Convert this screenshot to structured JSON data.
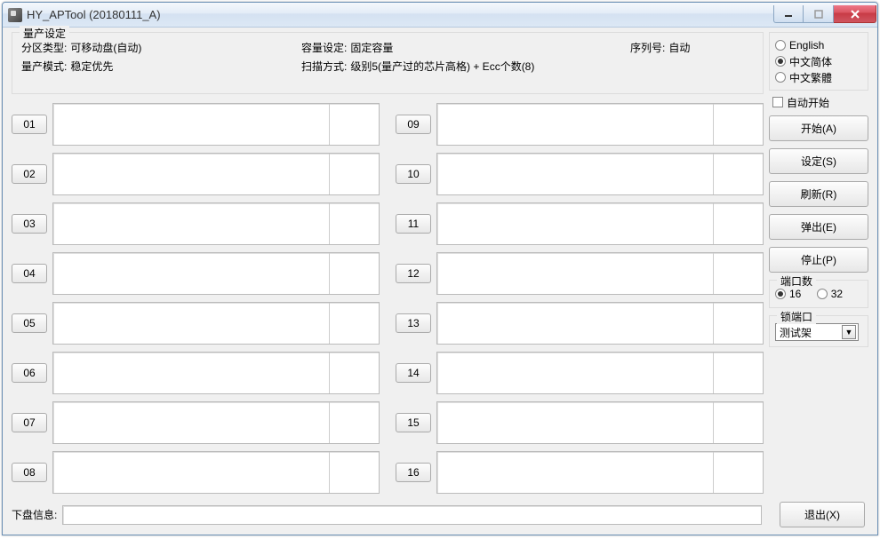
{
  "window": {
    "title": "HY_APTool (20180111_A)"
  },
  "settings": {
    "legend": "量产设定",
    "partition_type_label": "分区类型:",
    "partition_type_value": "可移动盘(自动)",
    "capacity_label": "容量设定:",
    "capacity_value": "固定容量",
    "serial_label": "序列号:",
    "serial_value": "自动",
    "prod_mode_label": "量产模式:",
    "prod_mode_value": "稳定优先",
    "scan_label": "扫描方式:",
    "scan_value": "级别5(量产过的芯片高格) + Ecc个数(8)"
  },
  "language": {
    "english": "English",
    "sc": "中文简体",
    "tc": "中文繁體",
    "selected": "sc"
  },
  "autostart_label": "自动开始",
  "buttons": {
    "start": "开始(A)",
    "settings": "设定(S)",
    "refresh": "刷新(R)",
    "eject": "弹出(E)",
    "stop": "停止(P)",
    "exit": "退出(X)"
  },
  "port_count": {
    "legend": "端口数",
    "opt16": "16",
    "opt32": "32",
    "selected": "16"
  },
  "lock_port": {
    "legend": "锁端口",
    "value": "测试架"
  },
  "ports_left": [
    "01",
    "02",
    "03",
    "04",
    "05",
    "06",
    "07",
    "08"
  ],
  "ports_right": [
    "09",
    "10",
    "11",
    "12",
    "13",
    "14",
    "15",
    "16"
  ],
  "disk_info_label": "下盘信息:"
}
